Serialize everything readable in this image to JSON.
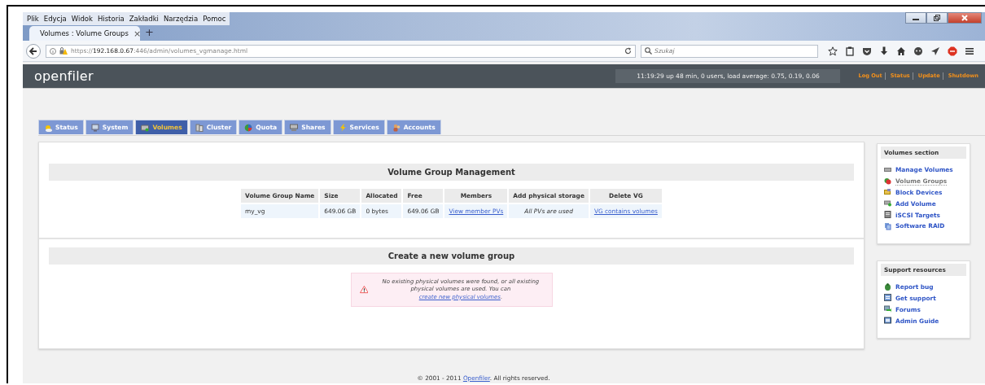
{
  "browser": {
    "menu": [
      "Plik",
      "Edycja",
      "Widok",
      "Historia",
      "Zakładki",
      "Narzędzia",
      "Pomoc"
    ],
    "tab_title": "Volumes : Volume Groups",
    "tab_close": "×",
    "new_tab": "+",
    "url_scheme": "https://",
    "url_host": "192.168.0.67",
    "url_path": ":446/admin/volumes_vgmanage.html",
    "search": {
      "placeholder": "Szukaj"
    }
  },
  "header": {
    "logo": "openfiler",
    "uptime": "11:19:29 up 48 min, 0 users, load average: 0.75, 0.19, 0.06",
    "links": [
      "Log Out",
      "Status",
      "Update",
      "Shutdown"
    ]
  },
  "tabs": [
    {
      "label": "Status",
      "selected": false
    },
    {
      "label": "System",
      "selected": false
    },
    {
      "label": "Volumes",
      "selected": true
    },
    {
      "label": "Cluster",
      "selected": false
    },
    {
      "label": "Quota",
      "selected": false
    },
    {
      "label": "Shares",
      "selected": false
    },
    {
      "label": "Services",
      "selected": false
    },
    {
      "label": "Accounts",
      "selected": false
    }
  ],
  "vg_section": {
    "title": "Volume Group Management",
    "columns": [
      "Volume Group Name",
      "Size",
      "Allocated",
      "Free",
      "Members",
      "Add physical storage",
      "Delete VG"
    ],
    "rows": [
      {
        "cells": [
          {
            "text": "my_vg",
            "kind": "text"
          },
          {
            "text": "649.06 GB",
            "kind": "text"
          },
          {
            "text": "0 bytes",
            "kind": "text"
          },
          {
            "text": "649.06 GB",
            "kind": "text"
          },
          {
            "text": "View member PVs",
            "kind": "link"
          },
          {
            "text": "All PVs are used",
            "kind": "note"
          },
          {
            "text": "VG contains volumes",
            "kind": "link"
          }
        ]
      }
    ]
  },
  "create_section": {
    "title": "Create a new volume group",
    "message": "No existing physical volumes were found, or all existing physical volumes are used. You can ",
    "link": "create new physical volumes",
    "after": "."
  },
  "sidebar": [
    {
      "title": "Volumes section",
      "items": [
        {
          "label": "Manage Volumes",
          "selected": false
        },
        {
          "label": "Volume Groups",
          "selected": true
        },
        {
          "label": "Block Devices",
          "selected": false
        },
        {
          "label": "Add Volume",
          "selected": false
        },
        {
          "label": "iSCSI Targets",
          "selected": false
        },
        {
          "label": "Software RAID",
          "selected": false
        }
      ]
    },
    {
      "title": "Support resources",
      "items": [
        {
          "label": "Report bug",
          "selected": false
        },
        {
          "label": "Get support",
          "selected": false
        },
        {
          "label": "Forums",
          "selected": false
        },
        {
          "label": "Admin Guide",
          "selected": false
        }
      ]
    }
  ],
  "footer": {
    "before": "© 2001 - 2011 ",
    "link": "Openfiler",
    "after": ". All rights reserved."
  }
}
